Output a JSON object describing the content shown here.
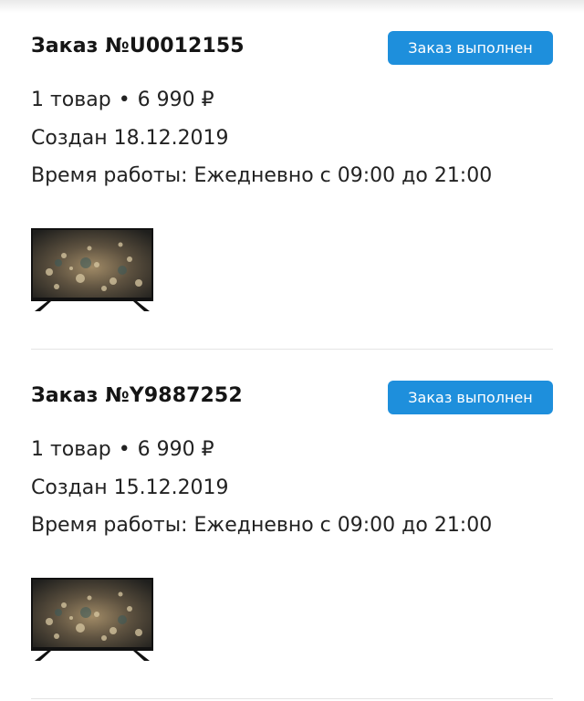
{
  "orders": [
    {
      "title": "Заказ №U0012155",
      "status": "Заказ выполнен",
      "items_count": "1 товар",
      "separator": "•",
      "price": "6 990 ₽",
      "created": "Создан 18.12.2019",
      "hours": "Время работы: Ежедневно с 09:00 до 21:00",
      "thumbnail_icon": "tv-icon"
    },
    {
      "title": "Заказ №Y9887252",
      "status": "Заказ выполнен",
      "items_count": "1 товар",
      "separator": "•",
      "price": "6 990 ₽",
      "created": "Создан 15.12.2019",
      "hours": "Время работы: Ежедневно с 09:00 до 21:00",
      "thumbnail_icon": "tv-icon"
    }
  ],
  "colors": {
    "badge": "#1e8fdc",
    "badge_text": "#ffffff",
    "divider": "#e4e4e4"
  }
}
